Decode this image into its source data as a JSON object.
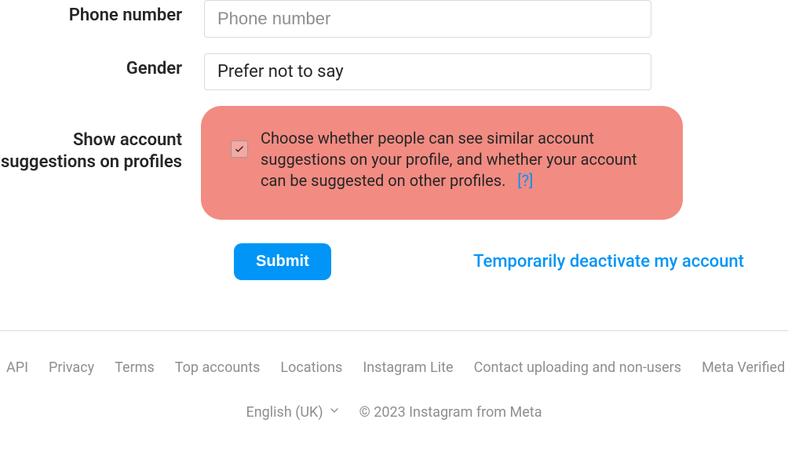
{
  "form": {
    "phone": {
      "label": "Phone number",
      "placeholder": "Phone number",
      "value": ""
    },
    "gender": {
      "label": "Gender",
      "value": "Prefer not to say"
    },
    "suggestions": {
      "label": "Show account suggestions on profiles",
      "checked": true,
      "description": "Choose whether people can see similar account suggestions on your profile, and whether your account can be suggested on other profiles.",
      "help": "[?]"
    },
    "submit": "Submit",
    "deactivate": "Temporarily deactivate my account"
  },
  "footer": {
    "links": [
      "API",
      "Privacy",
      "Terms",
      "Top accounts",
      "Locations",
      "Instagram Lite",
      "Contact uploading and non-users",
      "Meta Verified"
    ],
    "language": "English (UK)",
    "copyright": "© 2023 Instagram from Meta"
  }
}
